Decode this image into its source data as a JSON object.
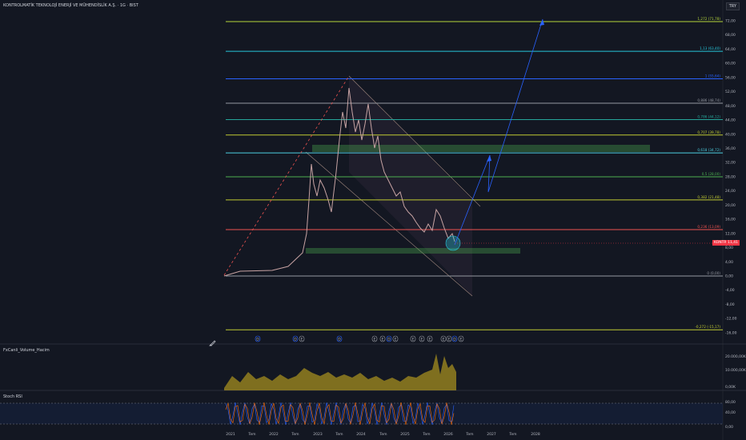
{
  "header": {
    "title": "KONTROLMATİK TEKNOLOJİ ENERJİ VE MÜHENDİSLİK A.Ş. · 1G · BIST",
    "currency": "TRY"
  },
  "price": {
    "ticker": "KONTR",
    "last": "11,41",
    "axis_ticks": [
      "72,00",
      "68,00",
      "64,00",
      "60,00",
      "56,00",
      "52,00",
      "48,00",
      "44,00",
      "40,00",
      "36,00",
      "32,00",
      "28,00",
      "24,00",
      "20,00",
      "16,00",
      "12,00",
      "8,00",
      "4,00",
      "0,00",
      "-4,00",
      "-8,00",
      "-12,00",
      "-16,00"
    ]
  },
  "fib_levels": [
    {
      "label": "1,272 (71,78)",
      "value": 71.78,
      "color": "#b5d63a"
    },
    {
      "label": "1,13 (63,40)",
      "value": 63.4,
      "color": "#26c6da"
    },
    {
      "label": "1 (55,64)",
      "value": 55.64,
      "color": "#2962ff"
    },
    {
      "label": "0,886 (48,74)",
      "value": 48.74,
      "color": "#9598a1"
    },
    {
      "label": "0,786 (44,12)",
      "value": 44.12,
      "color": "#26a69a"
    },
    {
      "label": "0,707 (39,78)",
      "value": 39.78,
      "color": "#c0ca33"
    },
    {
      "label": "0,618 (34,72)",
      "value": 34.72,
      "color": "#4dd0e1"
    },
    {
      "label": "0,5 (28,00)",
      "value": 28.0,
      "color": "#4caf50"
    },
    {
      "label": "0,382 (21,48)",
      "value": 21.48,
      "color": "#c0ca33"
    },
    {
      "label": "0,236 (13,09)",
      "value": 13.09,
      "color": "#ef5350"
    },
    {
      "label": "0 (0,00)",
      "value": 0.0,
      "color": "#9598a1"
    },
    {
      "label": "-0,272 (-15,17)",
      "value": -15.17,
      "color": "#c0ca33"
    }
  ],
  "volume_pane": {
    "label": "FxCanli_Volume_Hacim",
    "ticks": [
      "20.000,00K",
      "10.000,00K",
      "0,00K"
    ]
  },
  "stoch_pane": {
    "label": "Stoch RSI",
    "ticks": [
      "80,00",
      "40,00",
      "0,00"
    ]
  },
  "time_axis": [
    "2021",
    "Tem",
    "2022",
    "Tem",
    "2023",
    "Tem",
    "2024",
    "Tem",
    "2025",
    "Tem",
    "2026",
    "Tem",
    "2027",
    "Tem",
    "2028"
  ],
  "events": [
    "D",
    "D",
    "E",
    "D",
    "E",
    "E",
    "D",
    "E",
    "E",
    "E",
    "E",
    "E",
    "E",
    "D",
    "E"
  ]
}
